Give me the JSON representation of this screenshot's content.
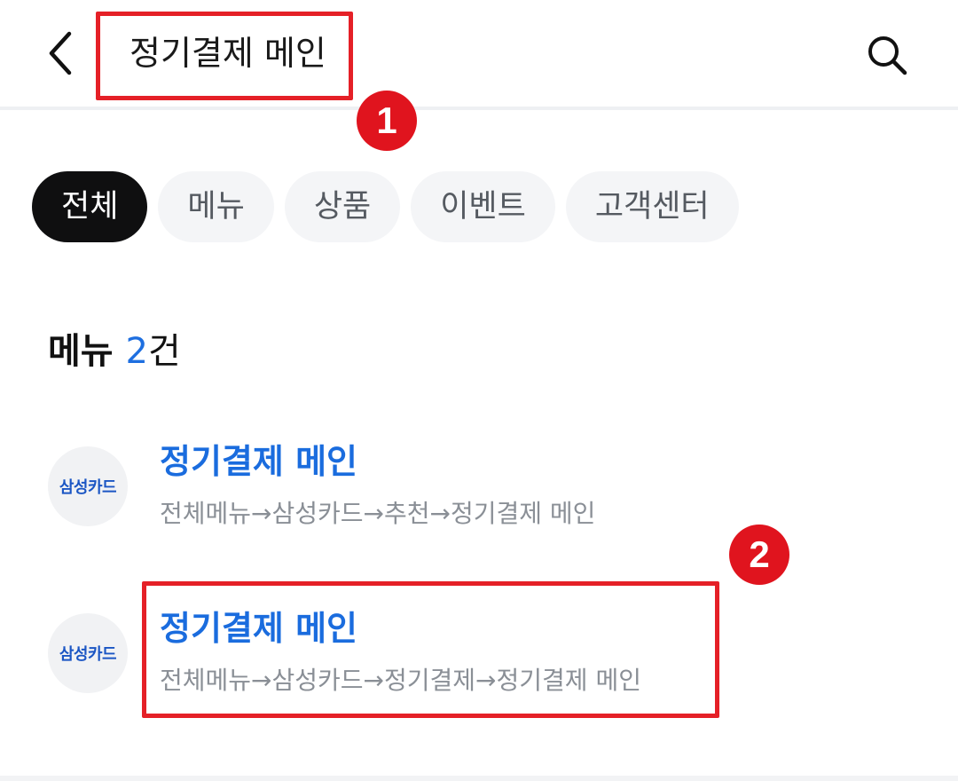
{
  "header": {
    "back_icon": "chevron-left-icon",
    "search_term": "정기결제 메인",
    "search_icon": "search-icon"
  },
  "filters": {
    "tabs": [
      {
        "label": "전체",
        "active": true
      },
      {
        "label": "메뉴",
        "active": false
      },
      {
        "label": "상품",
        "active": false
      },
      {
        "label": "이벤트",
        "active": false
      },
      {
        "label": "고객센터",
        "active": false
      }
    ]
  },
  "section": {
    "title": "메뉴",
    "count": "2",
    "unit": "건"
  },
  "results": [
    {
      "logo": "삼성카드",
      "title": "정기결제 메인",
      "path": "전체메뉴→삼성카드→추천→정기결제 메인"
    },
    {
      "logo": "삼성카드",
      "title": "정기결제 메인",
      "path": "전체메뉴→삼성카드→정기결제→정기결제 메인"
    }
  ],
  "annotations": {
    "badge_1": "1",
    "badge_2": "2",
    "color": "#e52027"
  },
  "colors": {
    "accent": "#1a6cde",
    "active_chip": "#0f0f10",
    "chip_bg": "#f4f5f7"
  }
}
